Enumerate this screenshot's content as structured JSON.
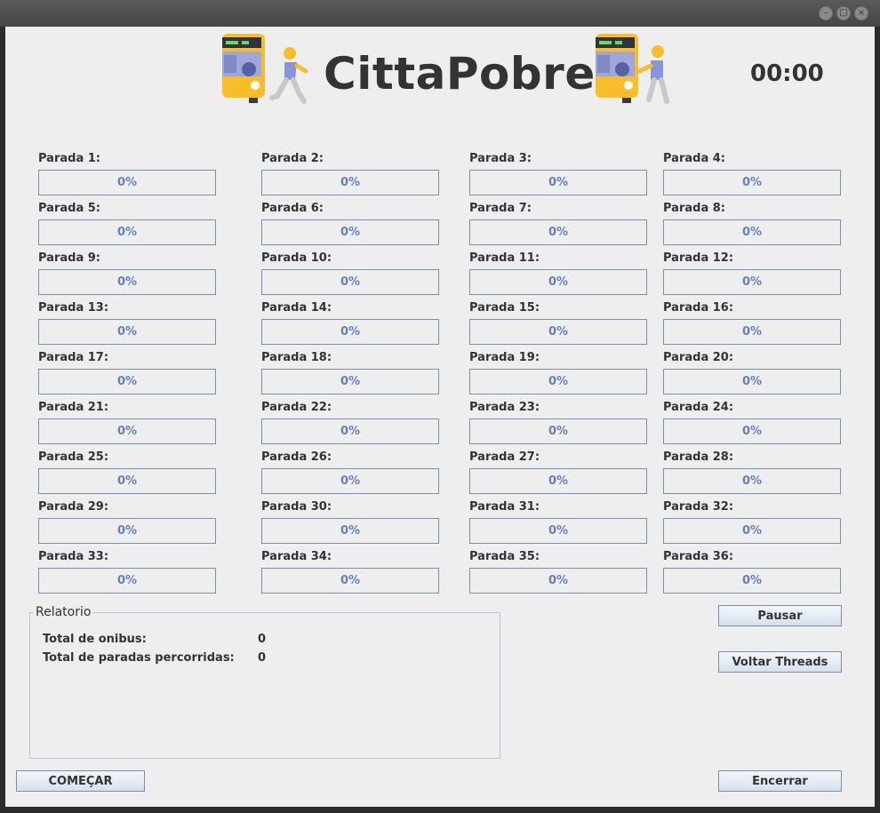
{
  "window": {
    "controls": [
      "minimize",
      "maximize",
      "close"
    ]
  },
  "header": {
    "title": "CittaPobre",
    "timer": "00:00",
    "logo_icon": "bus-passenger-icon"
  },
  "colors": {
    "accent": "#6381be",
    "bar_border": "#7a8fa8",
    "bus_yellow": "#f9bd2a"
  },
  "stops": [
    {
      "label": "Parada 1:",
      "progress": "0%",
      "value": 0
    },
    {
      "label": "Parada 2:",
      "progress": "0%",
      "value": 0
    },
    {
      "label": "Parada 3:",
      "progress": "0%",
      "value": 0
    },
    {
      "label": "Parada 4:",
      "progress": "0%",
      "value": 0
    },
    {
      "label": "Parada 5:",
      "progress": "0%",
      "value": 0
    },
    {
      "label": "Parada 6:",
      "progress": "0%",
      "value": 0
    },
    {
      "label": "Parada 7:",
      "progress": "0%",
      "value": 0
    },
    {
      "label": "Parada 8:",
      "progress": "0%",
      "value": 0
    },
    {
      "label": "Parada 9:",
      "progress": "0%",
      "value": 0
    },
    {
      "label": "Parada 10:",
      "progress": "0%",
      "value": 0
    },
    {
      "label": "Parada 11:",
      "progress": "0%",
      "value": 0
    },
    {
      "label": "Parada 12:",
      "progress": "0%",
      "value": 0
    },
    {
      "label": "Parada 13:",
      "progress": "0%",
      "value": 0
    },
    {
      "label": "Parada 14:",
      "progress": "0%",
      "value": 0
    },
    {
      "label": "Parada 15:",
      "progress": "0%",
      "value": 0
    },
    {
      "label": "Parada 16:",
      "progress": "0%",
      "value": 0
    },
    {
      "label": "Parada 17:",
      "progress": "0%",
      "value": 0
    },
    {
      "label": "Parada 18:",
      "progress": "0%",
      "value": 0
    },
    {
      "label": "Parada 19:",
      "progress": "0%",
      "value": 0
    },
    {
      "label": "Parada 20:",
      "progress": "0%",
      "value": 0
    },
    {
      "label": "Parada 21:",
      "progress": "0%",
      "value": 0
    },
    {
      "label": "Parada 22:",
      "progress": "0%",
      "value": 0
    },
    {
      "label": "Parada 23:",
      "progress": "0%",
      "value": 0
    },
    {
      "label": "Parada 24:",
      "progress": "0%",
      "value": 0
    },
    {
      "label": "Parada 25:",
      "progress": "0%",
      "value": 0
    },
    {
      "label": "Parada 26:",
      "progress": "0%",
      "value": 0
    },
    {
      "label": "Parada 27:",
      "progress": "0%",
      "value": 0
    },
    {
      "label": "Parada 28:",
      "progress": "0%",
      "value": 0
    },
    {
      "label": "Parada 29:",
      "progress": "0%",
      "value": 0
    },
    {
      "label": "Parada 30:",
      "progress": "0%",
      "value": 0
    },
    {
      "label": "Parada 31:",
      "progress": "0%",
      "value": 0
    },
    {
      "label": "Parada 32:",
      "progress": "0%",
      "value": 0
    },
    {
      "label": "Parada 33:",
      "progress": "0%",
      "value": 0
    },
    {
      "label": "Parada 34:",
      "progress": "0%",
      "value": 0
    },
    {
      "label": "Parada 35:",
      "progress": "0%",
      "value": 0
    },
    {
      "label": "Parada 36:",
      "progress": "0%",
      "value": 0
    }
  ],
  "report": {
    "title": "Relatorio",
    "total_buses_label": "Total de onibus:",
    "total_buses_value": "0",
    "total_stops_label": "Total de paradas percorridas:",
    "total_stops_value": "0"
  },
  "buttons": {
    "pause": "Pausar",
    "resume_threads": "Voltar Threads",
    "start": "COMEÇAR",
    "end": "Encerrar"
  }
}
